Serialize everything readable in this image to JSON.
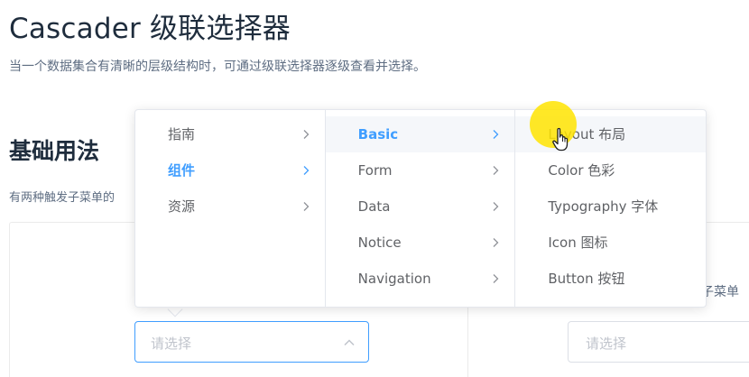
{
  "page": {
    "title": "Cascader 级联选择器",
    "description": "当一个数据集合有清晰的层级结构时，可通过级联选择器逐级查看并选择。"
  },
  "section": {
    "title": "基础用法",
    "description": "有两种触发子菜单的"
  },
  "demo": {
    "left_input_placeholder": "请选择",
    "right_label_partial": "子菜单",
    "right_input_placeholder": "请选择"
  },
  "cascader": {
    "columns": [
      {
        "items": [
          {
            "label": "指南",
            "has_children": true,
            "state": "normal"
          },
          {
            "label": "组件",
            "has_children": true,
            "state": "active-path"
          },
          {
            "label": "资源",
            "has_children": true,
            "state": "normal"
          }
        ]
      },
      {
        "items": [
          {
            "label": "Basic",
            "has_children": true,
            "state": "active-path-hover"
          },
          {
            "label": "Form",
            "has_children": true,
            "state": "normal"
          },
          {
            "label": "Data",
            "has_children": true,
            "state": "normal"
          },
          {
            "label": "Notice",
            "has_children": true,
            "state": "normal"
          },
          {
            "label": "Navigation",
            "has_children": true,
            "state": "normal"
          }
        ]
      },
      {
        "items": [
          {
            "label": "Layout 布局",
            "has_children": false,
            "state": "hover"
          },
          {
            "label": "Color 色彩",
            "has_children": false,
            "state": "normal"
          },
          {
            "label": "Typography 字体",
            "has_children": false,
            "state": "normal"
          },
          {
            "label": "Icon 图标",
            "has_children": false,
            "state": "normal"
          },
          {
            "label": "Button 按钮",
            "has_children": false,
            "state": "normal"
          }
        ]
      }
    ]
  },
  "colors": {
    "accent": "#409eff",
    "text": "#606266",
    "hover_bg": "#f5f7fa",
    "cursor_highlight": "#ffe400"
  },
  "icons": {
    "chevron": "chevron-right-icon",
    "input_arrow": "chevron-up-icon",
    "cursor": "hand-pointer-icon"
  }
}
